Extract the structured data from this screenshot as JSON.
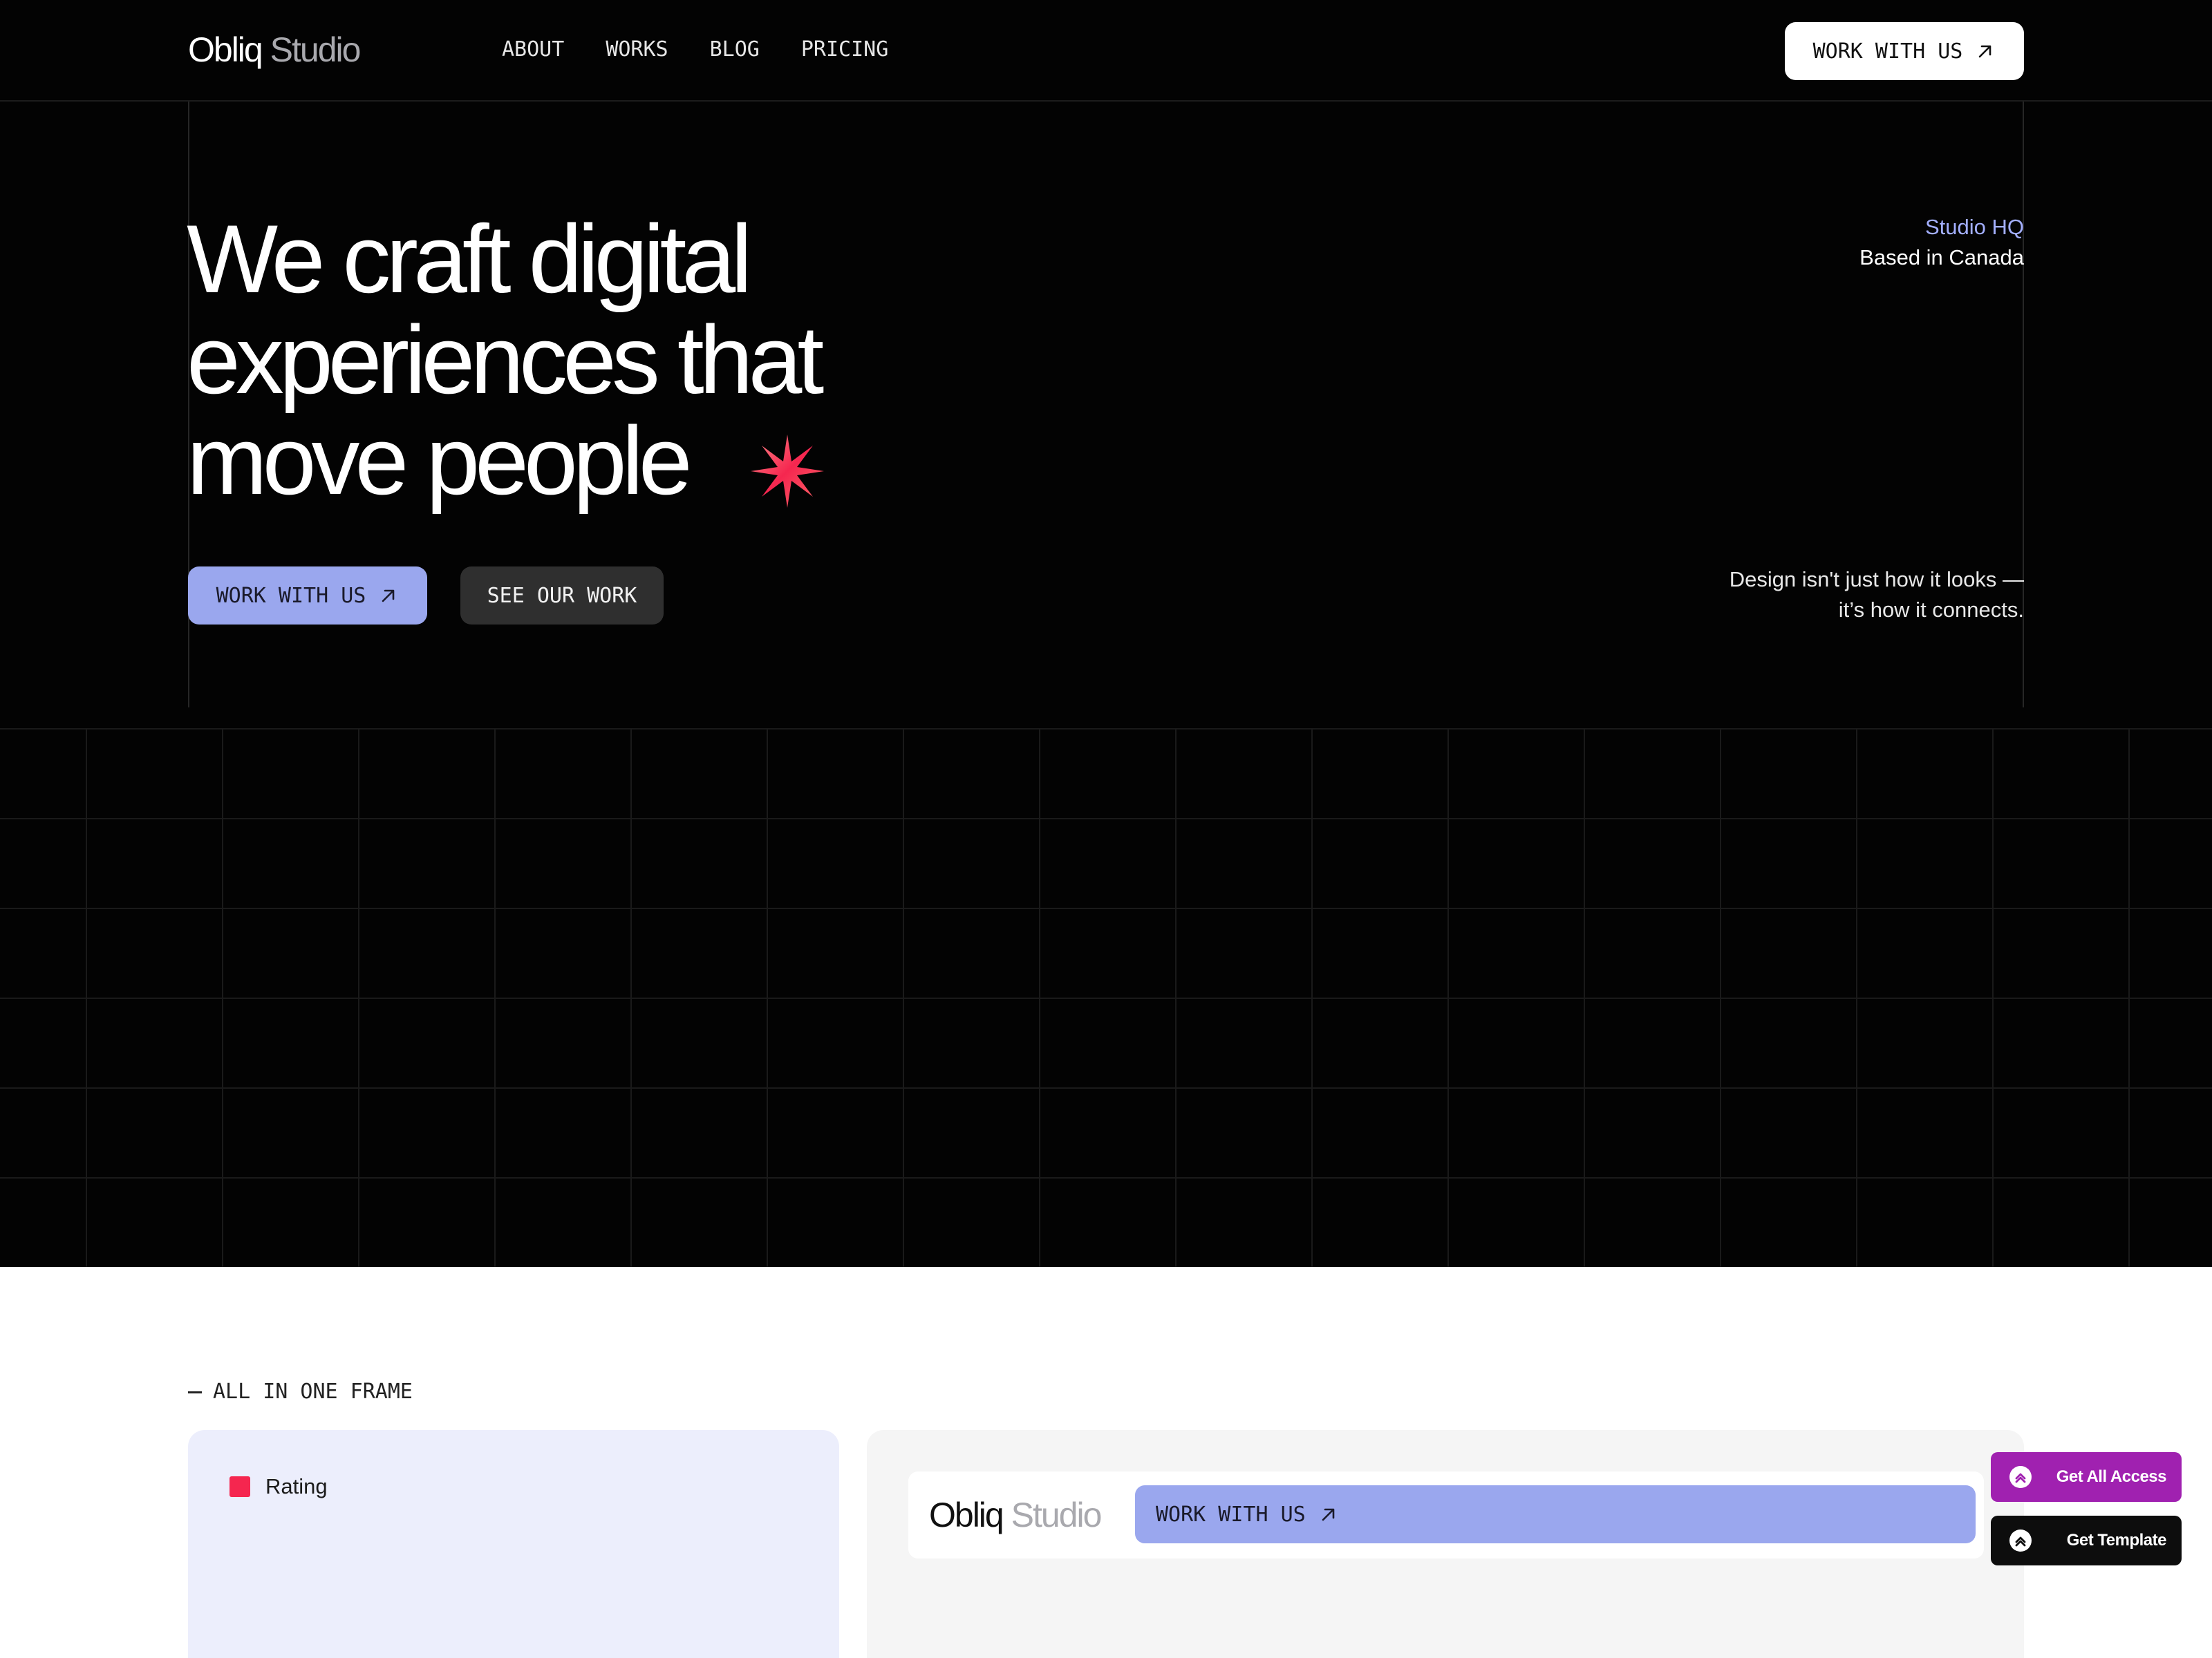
{
  "header": {
    "logo": {
      "word1": "Obliq",
      "word2": "Studio"
    },
    "nav": [
      {
        "label": "ABOUT"
      },
      {
        "label": "WORKS"
      },
      {
        "label": "BLOG"
      },
      {
        "label": "PRICING"
      }
    ],
    "cta_label": "WORK WITH US"
  },
  "hero": {
    "headline_lines": [
      "We craft digital",
      "experiences that",
      "move people"
    ],
    "primary_button": "WORK WITH US",
    "secondary_button": "SEE OUR WORK",
    "hq_title": "Studio HQ",
    "hq_location": "Based in Canada",
    "quote_lines": [
      "Design isn't just how it looks —",
      "it’s how it connects."
    ]
  },
  "section": {
    "label": "ALL IN ONE FRAME",
    "left_card": {
      "legend_label": "Rating"
    },
    "right_card": {
      "logo": {
        "word1": "Obliq",
        "word2": "Studio"
      },
      "cta_label": "WORK WITH US"
    }
  },
  "floating": {
    "access_label": "Get All Access",
    "template_label": "Get Template"
  },
  "colors": {
    "accent": "#9aa7ee",
    "star": "#f5264f",
    "access_badge": "#a021b0"
  },
  "icons": {
    "arrow": "arrow-up-right-icon",
    "star": "eight-point-star-icon",
    "badge": "framer-badge-icon"
  }
}
